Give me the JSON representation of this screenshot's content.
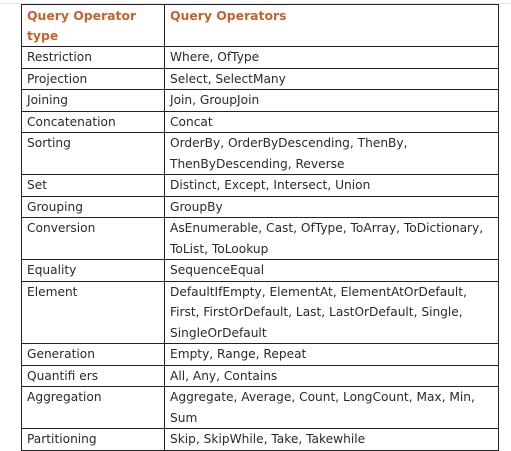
{
  "table": {
    "headers": [
      "Query Operator type",
      "Query Operators"
    ],
    "rows": [
      {
        "type": "Restriction",
        "operators": "Where, OfType"
      },
      {
        "type": "Projection",
        "operators": "Select, SelectMany"
      },
      {
        "type": "Joining",
        "operators": "Join, GroupJoin"
      },
      {
        "type": "Concatenation",
        "operators": "Concat"
      },
      {
        "type": "Sorting",
        "operators": "OrderBy, OrderByDescending, ThenBy, ThenByDescending, Reverse"
      },
      {
        "type": "Set",
        "operators": "Distinct, Except, Intersect, Union"
      },
      {
        "type": "Grouping",
        "operators": "GroupBy"
      },
      {
        "type": "Conversion",
        "operators": "AsEnumerable, Cast, OfType, ToArray, ToDictionary, ToList, ToLookup"
      },
      {
        "type": "Equality",
        "operators": "SequenceEqual"
      },
      {
        "type": "Element",
        "operators": "DefaultIfEmpty, ElementAt, ElementAtOrDefault, First, FirstOrDefault, Last, LastOrDefault, Single, SingleOrDefault"
      },
      {
        "type": "Generation",
        "operators": "Empty, Range, Repeat"
      },
      {
        "type": "Quantifi ers",
        "operators": "All, Any, Contains"
      },
      {
        "type": "Aggregation",
        "operators": "Aggregate, Average, Count, LongCount, Max, Min, Sum"
      },
      {
        "type": "Partitioning",
        "operators": "Skip, SkipWhile, Take, Takewhile"
      }
    ]
  },
  "colors": {
    "header_text": "#c4622c",
    "border": "#222222",
    "cell_text": "#2a2a2a"
  }
}
